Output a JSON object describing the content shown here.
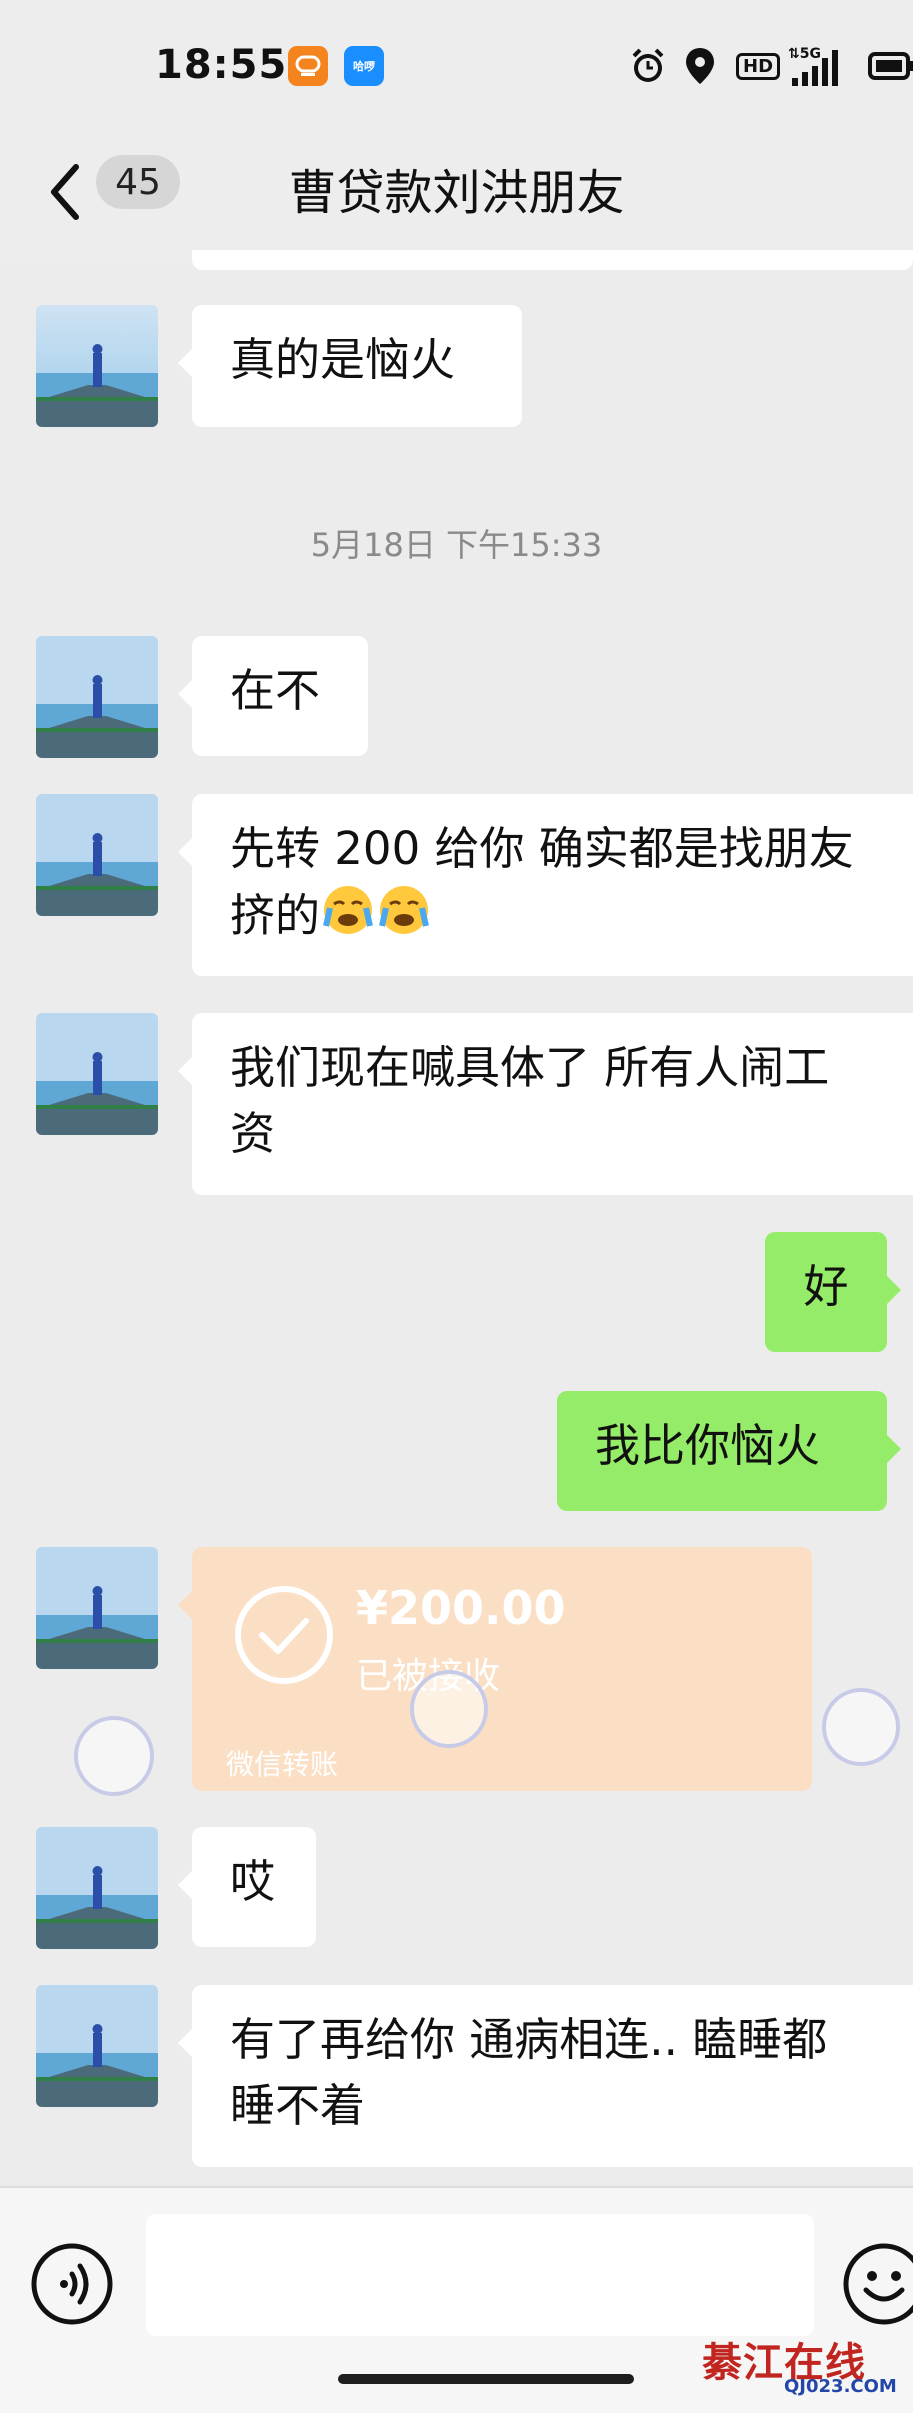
{
  "status_bar": {
    "time": "18:55",
    "app_icons": [
      {
        "name": "didi-icon",
        "label": "顺",
        "color": "#f5841f"
      },
      {
        "name": "hellobike-icon",
        "label": "哈啰",
        "color": "#1a8dff"
      }
    ],
    "icons": [
      "alarm-icon",
      "location-icon",
      "hd-icon",
      "5g-signal-icon",
      "battery-icon"
    ],
    "hd_label": "HD"
  },
  "nav": {
    "unread_count": "45",
    "title": "曹贷款刘洪朋友"
  },
  "chat": {
    "timestamp": "5月18日 下午15:33",
    "messages": [
      {
        "side": "left",
        "text": "真的是恼火"
      },
      {
        "side": "left",
        "text": "在不"
      },
      {
        "side": "left",
        "line1": "先转 200 给你 确实都是找朋友",
        "line2": "挤的",
        "emoji": [
          "sob-face-icon",
          "sob-face-icon"
        ]
      },
      {
        "side": "left",
        "line1": "我们现在喊具体了 所有人闹工",
        "line2": "资"
      },
      {
        "side": "right",
        "text": "好"
      },
      {
        "side": "right",
        "text": "我比你恼火"
      },
      {
        "side": "left",
        "text": "哎"
      },
      {
        "side": "left",
        "line1": "有了再给你 通病相连.. 瞌睡都",
        "line2": "睡不着"
      }
    ],
    "transfer": {
      "amount": "¥200.00",
      "status": "已被接收",
      "footer": "微信转账"
    }
  },
  "input_bar": {
    "voice_icon": "voice-mode-icon",
    "emoji_icon": "emoji-icon"
  },
  "watermark": {
    "main": "綦江在线",
    "sub": "QJ023.COM"
  },
  "colors": {
    "background": "#ececec",
    "received_bubble": "#ffffff",
    "sent_bubble": "#95ec69",
    "transfer_card": "#fbdfc4",
    "watermark_red": "#c0261f",
    "watermark_blue": "#2346a8"
  }
}
